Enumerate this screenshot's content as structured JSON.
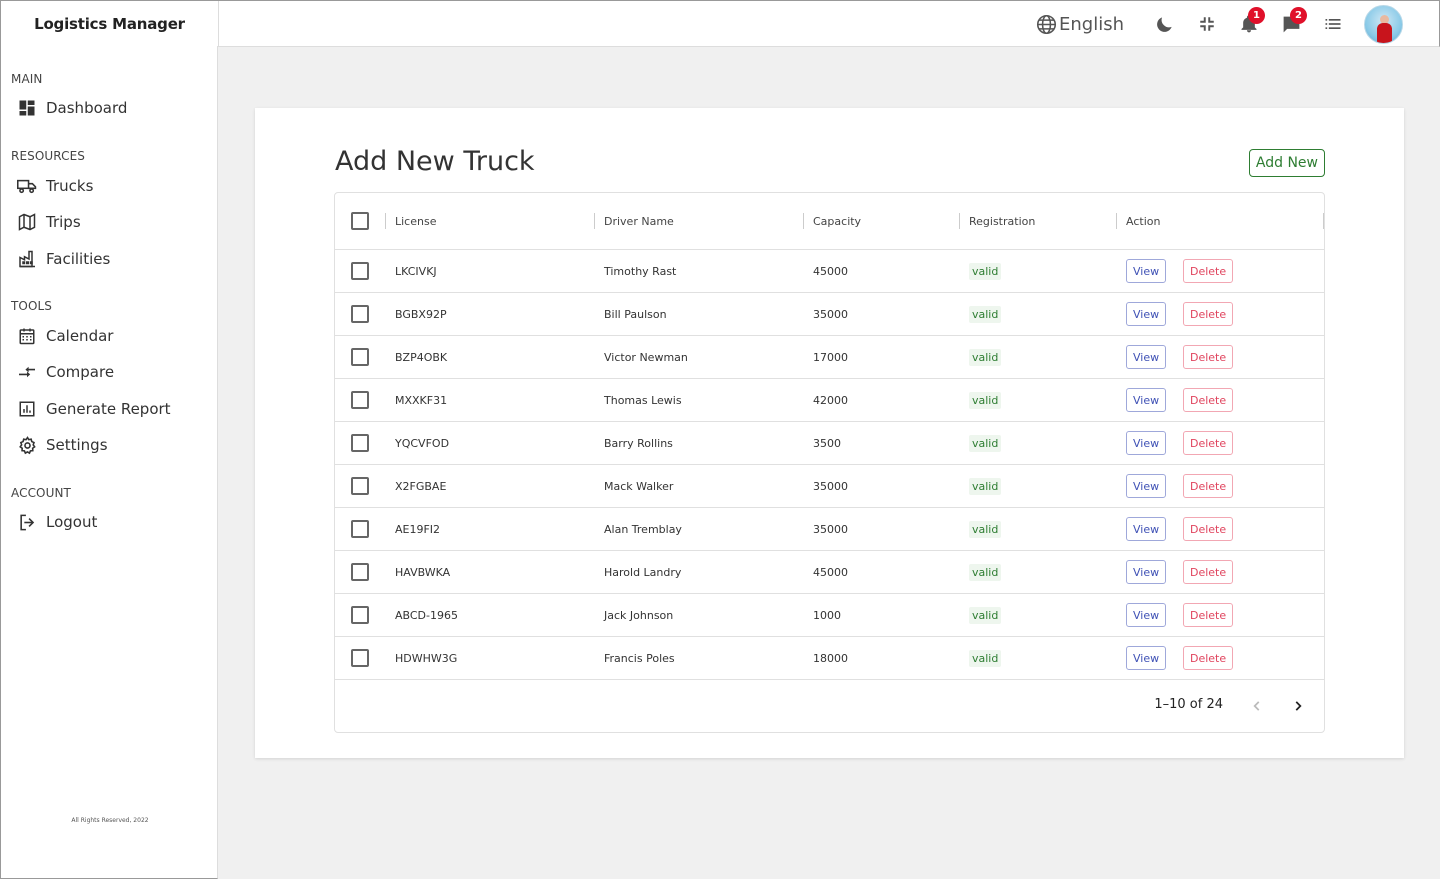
{
  "app": {
    "title": "Logistics Manager"
  },
  "header": {
    "language": "English",
    "notifications_count": "1",
    "messages_count": "2",
    "icons": [
      "globe-icon",
      "moon-icon",
      "compress-icon",
      "bell-icon",
      "chat-icon",
      "list-icon"
    ]
  },
  "sidebar": {
    "sections": {
      "main": "MAIN",
      "resources": "RESOURCES",
      "tools": "TOOLS",
      "account": "ACCOUNT"
    },
    "items": {
      "dashboard": "Dashboard",
      "trucks": "Trucks",
      "trips": "Trips",
      "facilities": "Facilities",
      "calendar": "Calendar",
      "compare": "Compare",
      "report": "Generate Report",
      "settings": "Settings",
      "logout": "Logout"
    },
    "footer": "All Rights Reserved, 2022"
  },
  "main": {
    "title": "Add New Truck",
    "add_button": "Add New",
    "columns": [
      "License",
      "Driver Name",
      "Capacity",
      "Registration",
      "Action"
    ],
    "rows": [
      {
        "license": "LKCIVKJ",
        "driver": "Timothy Rast",
        "capacity": "45000",
        "registration": "valid"
      },
      {
        "license": "BGBX92P",
        "driver": "Bill Paulson",
        "capacity": "35000",
        "registration": "valid"
      },
      {
        "license": "BZP4OBK",
        "driver": "Victor Newman",
        "capacity": "17000",
        "registration": "valid"
      },
      {
        "license": "MXXKF31",
        "driver": "Thomas Lewis",
        "capacity": "42000",
        "registration": "valid"
      },
      {
        "license": "YQCVFOD",
        "driver": "Barry Rollins",
        "capacity": "3500",
        "registration": "valid"
      },
      {
        "license": "X2FGBAE",
        "driver": "Mack Walker",
        "capacity": "35000",
        "registration": "valid"
      },
      {
        "license": "AE19FI2",
        "driver": "Alan Tremblay",
        "capacity": "35000",
        "registration": "valid"
      },
      {
        "license": "HAVBWKA",
        "driver": "Harold Landry",
        "capacity": "45000",
        "registration": "valid"
      },
      {
        "license": "ABCD-1965",
        "driver": "Jack Johnson",
        "capacity": "1000",
        "registration": "valid"
      },
      {
        "license": "HDWHW3G",
        "driver": "Francis Poles",
        "capacity": "18000",
        "registration": "valid"
      }
    ],
    "view_label": "View",
    "delete_label": "Delete",
    "pagination": "1–10 of 24"
  },
  "colors": {
    "valid": "#2e7d32",
    "view": "#3f51b5",
    "delete": "#e0445e",
    "badge": "#e0102a"
  }
}
